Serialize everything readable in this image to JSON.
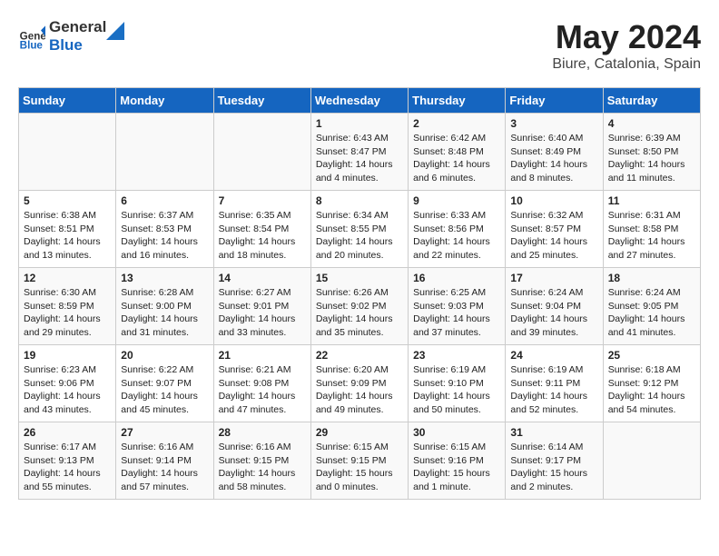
{
  "header": {
    "logo_general": "General",
    "logo_blue": "Blue",
    "month_year": "May 2024",
    "location": "Biure, Catalonia, Spain"
  },
  "days_of_week": [
    "Sunday",
    "Monday",
    "Tuesday",
    "Wednesday",
    "Thursday",
    "Friday",
    "Saturday"
  ],
  "weeks": [
    [
      {
        "day": "",
        "text": ""
      },
      {
        "day": "",
        "text": ""
      },
      {
        "day": "",
        "text": ""
      },
      {
        "day": "1",
        "text": "Sunrise: 6:43 AM\nSunset: 8:47 PM\nDaylight: 14 hours\nand 4 minutes."
      },
      {
        "day": "2",
        "text": "Sunrise: 6:42 AM\nSunset: 8:48 PM\nDaylight: 14 hours\nand 6 minutes."
      },
      {
        "day": "3",
        "text": "Sunrise: 6:40 AM\nSunset: 8:49 PM\nDaylight: 14 hours\nand 8 minutes."
      },
      {
        "day": "4",
        "text": "Sunrise: 6:39 AM\nSunset: 8:50 PM\nDaylight: 14 hours\nand 11 minutes."
      }
    ],
    [
      {
        "day": "5",
        "text": "Sunrise: 6:38 AM\nSunset: 8:51 PM\nDaylight: 14 hours\nand 13 minutes."
      },
      {
        "day": "6",
        "text": "Sunrise: 6:37 AM\nSunset: 8:53 PM\nDaylight: 14 hours\nand 16 minutes."
      },
      {
        "day": "7",
        "text": "Sunrise: 6:35 AM\nSunset: 8:54 PM\nDaylight: 14 hours\nand 18 minutes."
      },
      {
        "day": "8",
        "text": "Sunrise: 6:34 AM\nSunset: 8:55 PM\nDaylight: 14 hours\nand 20 minutes."
      },
      {
        "day": "9",
        "text": "Sunrise: 6:33 AM\nSunset: 8:56 PM\nDaylight: 14 hours\nand 22 minutes."
      },
      {
        "day": "10",
        "text": "Sunrise: 6:32 AM\nSunset: 8:57 PM\nDaylight: 14 hours\nand 25 minutes."
      },
      {
        "day": "11",
        "text": "Sunrise: 6:31 AM\nSunset: 8:58 PM\nDaylight: 14 hours\nand 27 minutes."
      }
    ],
    [
      {
        "day": "12",
        "text": "Sunrise: 6:30 AM\nSunset: 8:59 PM\nDaylight: 14 hours\nand 29 minutes."
      },
      {
        "day": "13",
        "text": "Sunrise: 6:28 AM\nSunset: 9:00 PM\nDaylight: 14 hours\nand 31 minutes."
      },
      {
        "day": "14",
        "text": "Sunrise: 6:27 AM\nSunset: 9:01 PM\nDaylight: 14 hours\nand 33 minutes."
      },
      {
        "day": "15",
        "text": "Sunrise: 6:26 AM\nSunset: 9:02 PM\nDaylight: 14 hours\nand 35 minutes."
      },
      {
        "day": "16",
        "text": "Sunrise: 6:25 AM\nSunset: 9:03 PM\nDaylight: 14 hours\nand 37 minutes."
      },
      {
        "day": "17",
        "text": "Sunrise: 6:24 AM\nSunset: 9:04 PM\nDaylight: 14 hours\nand 39 minutes."
      },
      {
        "day": "18",
        "text": "Sunrise: 6:24 AM\nSunset: 9:05 PM\nDaylight: 14 hours\nand 41 minutes."
      }
    ],
    [
      {
        "day": "19",
        "text": "Sunrise: 6:23 AM\nSunset: 9:06 PM\nDaylight: 14 hours\nand 43 minutes."
      },
      {
        "day": "20",
        "text": "Sunrise: 6:22 AM\nSunset: 9:07 PM\nDaylight: 14 hours\nand 45 minutes."
      },
      {
        "day": "21",
        "text": "Sunrise: 6:21 AM\nSunset: 9:08 PM\nDaylight: 14 hours\nand 47 minutes."
      },
      {
        "day": "22",
        "text": "Sunrise: 6:20 AM\nSunset: 9:09 PM\nDaylight: 14 hours\nand 49 minutes."
      },
      {
        "day": "23",
        "text": "Sunrise: 6:19 AM\nSunset: 9:10 PM\nDaylight: 14 hours\nand 50 minutes."
      },
      {
        "day": "24",
        "text": "Sunrise: 6:19 AM\nSunset: 9:11 PM\nDaylight: 14 hours\nand 52 minutes."
      },
      {
        "day": "25",
        "text": "Sunrise: 6:18 AM\nSunset: 9:12 PM\nDaylight: 14 hours\nand 54 minutes."
      }
    ],
    [
      {
        "day": "26",
        "text": "Sunrise: 6:17 AM\nSunset: 9:13 PM\nDaylight: 14 hours\nand 55 minutes."
      },
      {
        "day": "27",
        "text": "Sunrise: 6:16 AM\nSunset: 9:14 PM\nDaylight: 14 hours\nand 57 minutes."
      },
      {
        "day": "28",
        "text": "Sunrise: 6:16 AM\nSunset: 9:15 PM\nDaylight: 14 hours\nand 58 minutes."
      },
      {
        "day": "29",
        "text": "Sunrise: 6:15 AM\nSunset: 9:15 PM\nDaylight: 15 hours\nand 0 minutes."
      },
      {
        "day": "30",
        "text": "Sunrise: 6:15 AM\nSunset: 9:16 PM\nDaylight: 15 hours\nand 1 minute."
      },
      {
        "day": "31",
        "text": "Sunrise: 6:14 AM\nSunset: 9:17 PM\nDaylight: 15 hours\nand 2 minutes."
      },
      {
        "day": "",
        "text": ""
      }
    ]
  ]
}
